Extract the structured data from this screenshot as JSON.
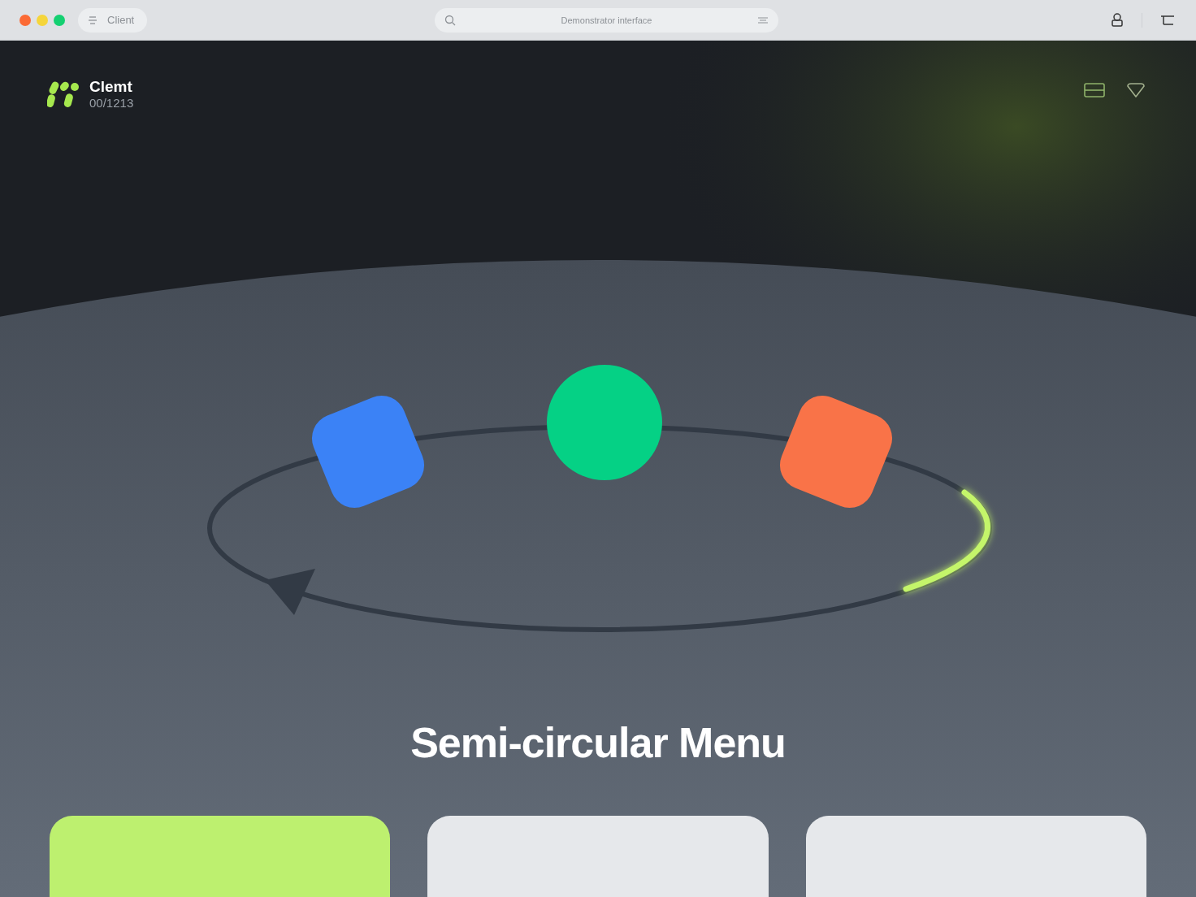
{
  "browser": {
    "tab": {
      "label": "Client"
    },
    "search": {
      "placeholder": "Demonstrator interface"
    }
  },
  "brand": {
    "name": "Clemt",
    "code": "00/1213"
  },
  "menu": {
    "items": [
      {
        "kind": "rounded-square",
        "color": "#3b82f6"
      },
      {
        "kind": "circle",
        "color": "#05d185"
      },
      {
        "kind": "rounded-square",
        "color": "#f97348"
      }
    ]
  },
  "title": "Semi-circular Menu",
  "cards": [
    {
      "selected": true
    },
    {
      "selected": false
    },
    {
      "selected": false
    }
  ]
}
